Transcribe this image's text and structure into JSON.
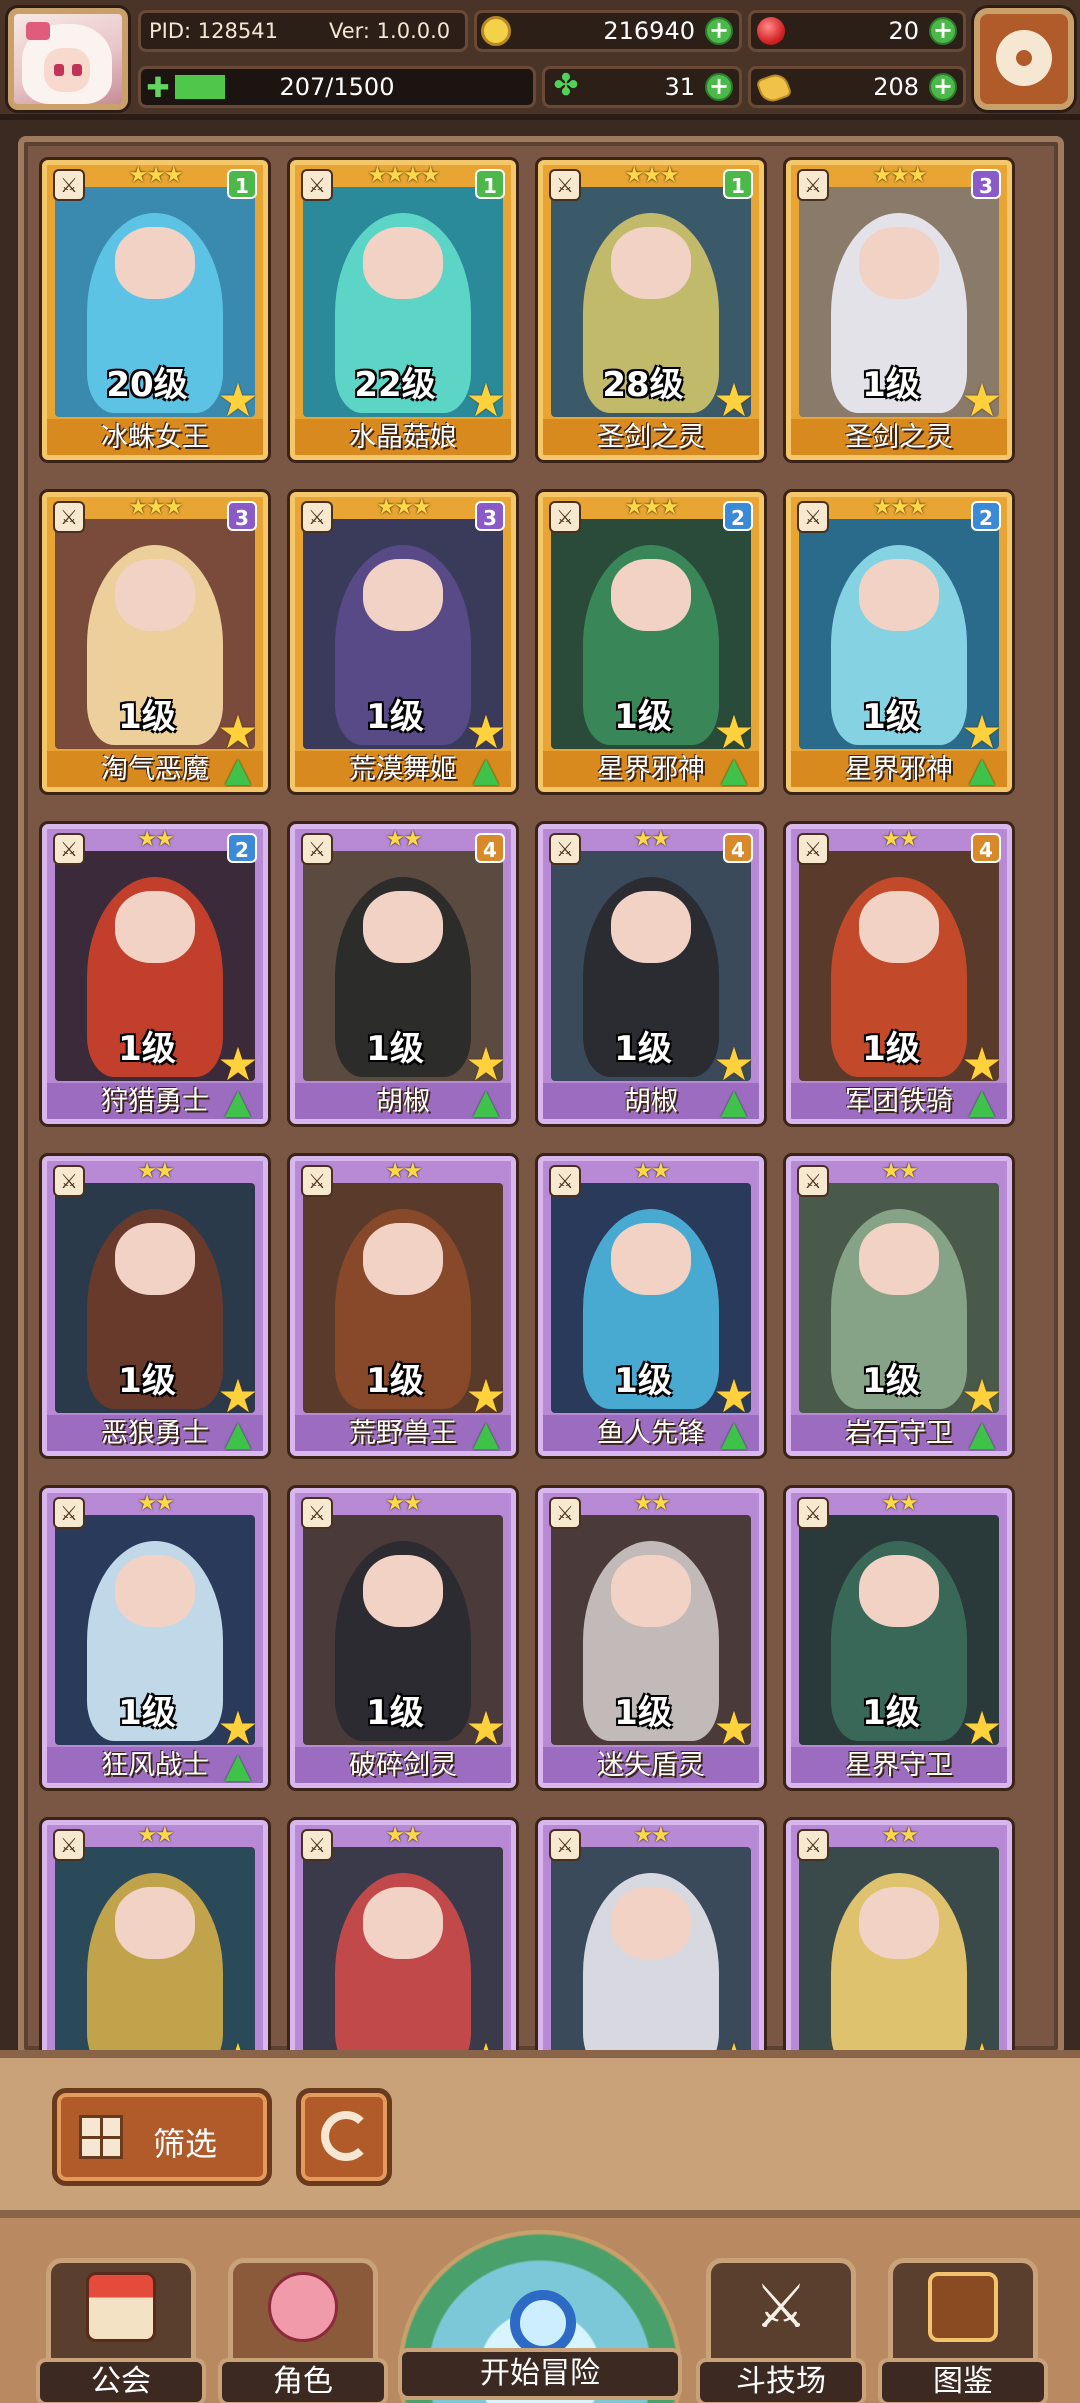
{
  "header": {
    "pid_label": "PID: 128541",
    "version_label": "Ver: 1.0.0.0",
    "gold": "216940",
    "gems": "20",
    "energy": "207/1500",
    "energy_fraction": 0.138,
    "clover": "31",
    "bread": "208"
  },
  "cards": [
    {
      "name": "冰蛛女王",
      "level": "20级",
      "badge": "1",
      "tier": "gold",
      "stars": "★★★",
      "art_color": "#3a8ab0",
      "figure_color": "#5fc6e8",
      "upgrade": false
    },
    {
      "name": "水晶菇娘",
      "level": "22级",
      "badge": "1",
      "tier": "gold",
      "stars": "★★★★",
      "art_color": "#2a8a9a",
      "figure_color": "#5fd8c8",
      "upgrade": false
    },
    {
      "name": "圣剑之灵",
      "level": "28级",
      "badge": "1",
      "tier": "gold",
      "stars": "★★★",
      "art_color": "#3a5a6a",
      "figure_color": "#c8c06a",
      "upgrade": false
    },
    {
      "name": "圣剑之灵",
      "level": "1级",
      "badge": "3",
      "tier": "gold",
      "stars": "★★★",
      "art_color": "#8a7a6a",
      "figure_color": "#e8e8f0",
      "upgrade": false
    },
    {
      "name": "淘气恶魔",
      "level": "1级",
      "badge": "3",
      "tier": "gold",
      "stars": "★★★",
      "art_color": "#7a4a3a",
      "figure_color": "#f3d6a0",
      "upgrade": true
    },
    {
      "name": "荒漠舞姬",
      "level": "1级",
      "badge": "3",
      "tier": "gold",
      "stars": "★★★",
      "art_color": "#3a3a5a",
      "figure_color": "#5a4a8a",
      "upgrade": true
    },
    {
      "name": "星界邪神",
      "level": "1级",
      "badge": "2",
      "tier": "gold",
      "stars": "★★★",
      "art_color": "#2a4a3a",
      "figure_color": "#3a8a5a",
      "upgrade": true
    },
    {
      "name": "星界邪神",
      "level": "1级",
      "badge": "2",
      "tier": "gold",
      "stars": "★★★",
      "art_color": "#2a6a8a",
      "figure_color": "#8ad8e8",
      "upgrade": true
    },
    {
      "name": "狩猎勇士",
      "level": "1级",
      "badge": "2",
      "tier": "purple",
      "stars": "★★",
      "art_color": "#3a2a3a",
      "figure_color": "#c8402a",
      "upgrade": true
    },
    {
      "name": "胡椒",
      "level": "1级",
      "badge": "4",
      "tier": "purple",
      "stars": "★★",
      "art_color": "#5a4a40",
      "figure_color": "#2a2a2a",
      "upgrade": true
    },
    {
      "name": "胡椒",
      "level": "1级",
      "badge": "4",
      "tier": "purple",
      "stars": "★★",
      "art_color": "#3a4a5a",
      "figure_color": "#2a2a30",
      "upgrade": true
    },
    {
      "name": "军团铁骑",
      "level": "1级",
      "badge": "4",
      "tier": "purple",
      "stars": "★★",
      "art_color": "#5a3a2a",
      "figure_color": "#c84a2a",
      "upgrade": true
    },
    {
      "name": "恶狼勇士",
      "level": "1级",
      "badge": "",
      "tier": "purple",
      "stars": "★★",
      "art_color": "#2a3a4a",
      "figure_color": "#6a3a2a",
      "upgrade": true
    },
    {
      "name": "荒野兽王",
      "level": "1级",
      "badge": "",
      "tier": "purple",
      "stars": "★★",
      "art_color": "#5a3a2a",
      "figure_color": "#8a4a2a",
      "upgrade": true
    },
    {
      "name": "鱼人先锋",
      "level": "1级",
      "badge": "",
      "tier": "purple",
      "stars": "★★",
      "art_color": "#2a3a5a",
      "figure_color": "#4ab0d8",
      "upgrade": true
    },
    {
      "name": "岩石守卫",
      "level": "1级",
      "badge": "",
      "tier": "purple",
      "stars": "★★",
      "art_color": "#4a5a4a",
      "figure_color": "#8aa88a",
      "upgrade": true
    },
    {
      "name": "狂风战士",
      "level": "1级",
      "badge": "",
      "tier": "purple",
      "stars": "★★",
      "art_color": "#2a3a5a",
      "figure_color": "#c8e0f0",
      "upgrade": true
    },
    {
      "name": "破碎剑灵",
      "level": "1级",
      "badge": "",
      "tier": "purple",
      "stars": "★★",
      "art_color": "#4a3a3a",
      "figure_color": "#2a2a30",
      "upgrade": false
    },
    {
      "name": "迷失盾灵",
      "level": "1级",
      "badge": "",
      "tier": "purple",
      "stars": "★★",
      "art_color": "#4a3a3a",
      "figure_color": "#c8c0c0",
      "upgrade": false
    },
    {
      "name": "星界守卫",
      "level": "1级",
      "badge": "",
      "tier": "purple",
      "stars": "★★",
      "art_color": "#2a3a3a",
      "figure_color": "#3a6a5a",
      "upgrade": false
    },
    {
      "name": "",
      "level": "",
      "badge": "",
      "tier": "purple",
      "stars": "★★",
      "art_color": "#2a4a5a",
      "figure_color": "#c8a84a",
      "upgrade": false
    },
    {
      "name": "",
      "level": "",
      "badge": "",
      "tier": "purple",
      "stars": "★★",
      "art_color": "#3a3a4a",
      "figure_color": "#c84a4a",
      "upgrade": false
    },
    {
      "name": "",
      "level": "",
      "badge": "",
      "tier": "purple",
      "stars": "★★",
      "art_color": "#3a4a5a",
      "figure_color": "#e0e0e8",
      "upgrade": false
    },
    {
      "name": "",
      "level": "",
      "badge": "",
      "tier": "purple",
      "stars": "★★",
      "art_color": "#3a4a4a",
      "figure_color": "#e8c870",
      "upgrade": false
    }
  ],
  "toolbar": {
    "filter_label": "筛选"
  },
  "nav": {
    "guild": "公会",
    "character": "角色",
    "adventure": "开始冒险",
    "arena": "斗技场",
    "codex": "图鉴"
  },
  "colors": {
    "gold_card": "#e9a533",
    "purple_card": "#b88ad6",
    "badge_green": "#4cb84a",
    "badge_purple": "#8a5ac8",
    "badge_blue": "#3a8ad8",
    "badge_orange": "#d88a2a"
  },
  "icons": {
    "avatar": "avatar-portrait",
    "settings": "gear-icon",
    "gold": "coin-icon",
    "gems": "gem-icon",
    "energy": "energy-icon",
    "clover": "clover-icon",
    "bread": "bread-icon",
    "filter": "grid-icon",
    "refresh": "refresh-icon"
  }
}
